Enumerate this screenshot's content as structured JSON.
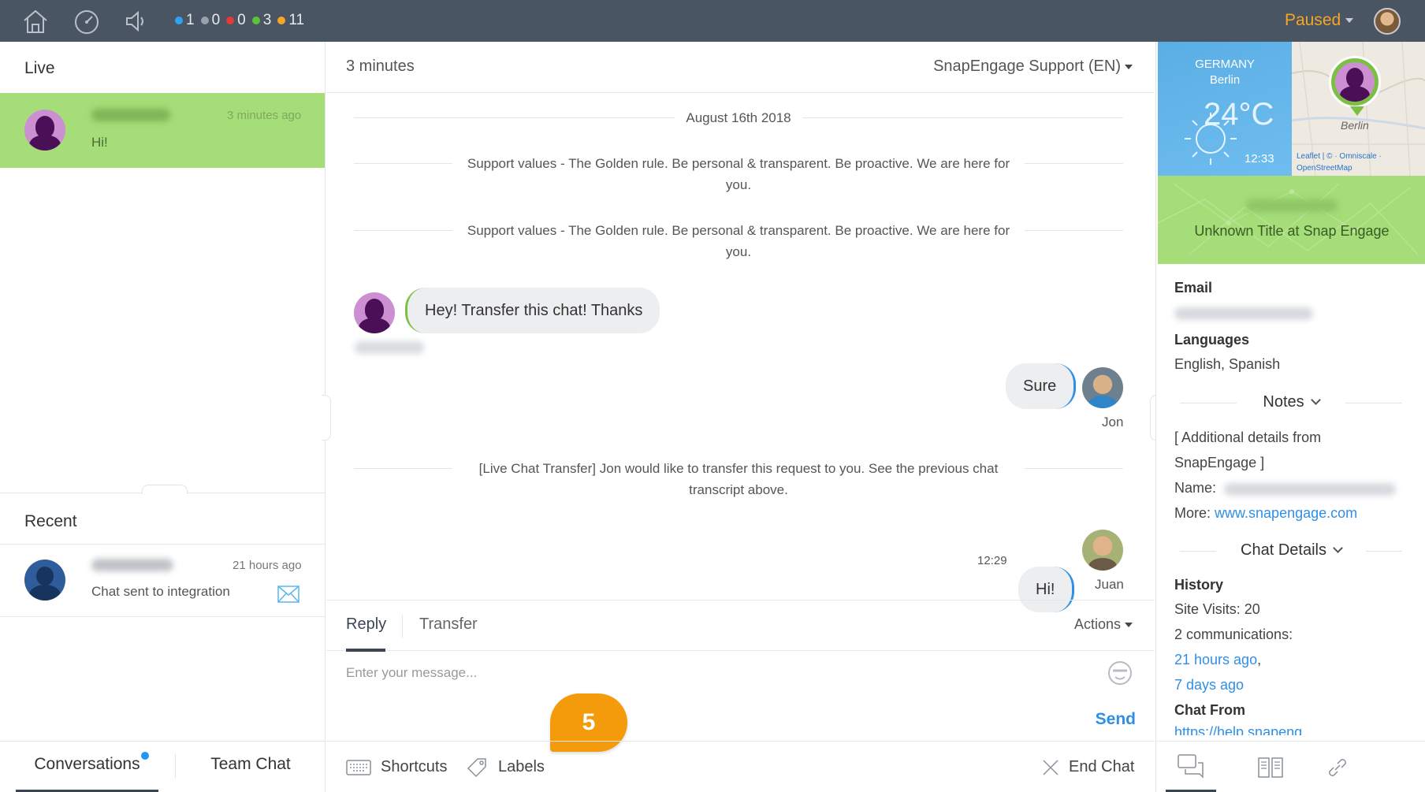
{
  "topbar": {
    "counters": [
      {
        "value": "1",
        "color": "#2ea3f2"
      },
      {
        "value": "0",
        "color": "#9aa1a9"
      },
      {
        "value": "0",
        "color": "#e53935"
      },
      {
        "value": "3",
        "color": "#5cc23a"
      },
      {
        "value": "11",
        "color": "#f5a623"
      }
    ],
    "status": "Paused",
    "icons": [
      "home-icon",
      "dashboard-icon",
      "sound-icon"
    ]
  },
  "left": {
    "live_title": "Live",
    "live_item": {
      "time": "3 minutes ago",
      "message": "Hi!"
    },
    "recent_title": "Recent",
    "recent_item": {
      "time": "21 hours ago",
      "message": "Chat sent to integration"
    },
    "tabs": {
      "conversations": "Conversations",
      "team_chat": "Team Chat"
    }
  },
  "chat": {
    "duration": "3 minutes",
    "queue": "SnapEngage Support (EN)",
    "date": "August 16th 2018",
    "system_1": "Support values - The Golden rule. Be personal & transparent. Be proactive. We are here for you.",
    "system_2": "Support values - The Golden rule. Be personal & transparent. Be proactive. We are here for you.",
    "visitor_message": "Hey! Transfer this chat! Thanks",
    "jon_message": "Sure",
    "jon_name": "Jon",
    "transfer_notice": "[Live Chat Transfer] Jon would like to transfer this request to you. See the previous chat transcript above.",
    "juan_message": "Hi!",
    "juan_time": "12:29",
    "juan_name": "Juan"
  },
  "reply": {
    "tab_reply": "Reply",
    "tab_transfer": "Transfer",
    "actions": "Actions",
    "placeholder": "Enter your message...",
    "send": "Send",
    "badge": "5",
    "shortcuts": "Shortcuts",
    "labels": "Labels",
    "end_chat": "End Chat"
  },
  "visitor": {
    "weather": {
      "country": "GERMANY",
      "city": "Berlin",
      "temp": "24°C",
      "time": "12:33"
    },
    "map": {
      "label": "Berlin",
      "credit_line1": "Leaflet | © · Omniscale ·",
      "credit_line2": "OpenStreetMap"
    },
    "title": "Unknown Title at Snap Engage",
    "email_label": "Email",
    "languages_label": "Languages",
    "languages": "English, Spanish",
    "notes_label": "Notes",
    "notes_line1": "[ Additional details from",
    "notes_line2": "SnapEngage ]",
    "name_label": "Name:",
    "more_label": "More:",
    "more_link": "www.snapengage.com",
    "chat_details_label": "Chat Details",
    "history_label": "History",
    "site_visits": "Site Visits: 20",
    "communications": "2 communications:",
    "comm_1": "21 hours ago",
    "comm_sep": ",",
    "comm_2": "7 days ago",
    "chat_from_label": "Chat From",
    "chat_from_link": "https://help.snapeng..."
  }
}
